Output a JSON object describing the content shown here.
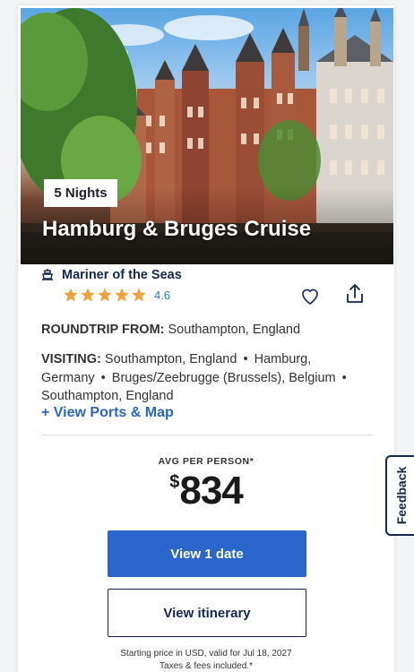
{
  "listing": {
    "nights_badge": "5 Nights",
    "title": "Hamburg & Bruges Cruise",
    "ship": {
      "icon": "ship-icon",
      "name": "Mariner of the Seas"
    },
    "rating": {
      "stars": 5,
      "value": "4.6",
      "star_color": "#f0a33a"
    },
    "roundtrip_label": "ROUNDTRIP FROM:",
    "roundtrip_value": "Southampton, England",
    "visiting_label": "VISITING:",
    "ports": [
      "Southampton, England",
      "Hamburg, Germany",
      "Bruges/Zeebrugge (Brussels), Belgium",
      "Southampton, England"
    ],
    "port_separator": "•",
    "view_ports_link": "+ View Ports & Map"
  },
  "pricing": {
    "avg_label": "AVG PER PERSON*",
    "currency_symbol": "$",
    "amount": "834",
    "primary_button": "View 1 date",
    "secondary_button": "View itinerary",
    "disclaimer_line1": "Starting price in USD, valid for Jul 18, 2027",
    "disclaimer_line2": "Taxes & fees included.*"
  },
  "actions": {
    "favorite_icon": "heart-icon",
    "share_icon": "share-icon"
  },
  "feedback_tab": "Feedback",
  "colors": {
    "primary_blue": "#2a66cc",
    "navy": "#15264f",
    "link_blue": "#2a66c5"
  }
}
